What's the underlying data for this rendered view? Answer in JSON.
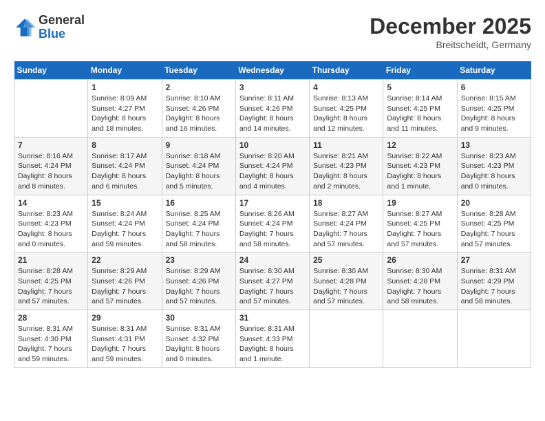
{
  "header": {
    "logo": {
      "general": "General",
      "blue": "Blue"
    },
    "month": "December 2025",
    "location": "Breitscheidt, Germany"
  },
  "weekdays": [
    "Sunday",
    "Monday",
    "Tuesday",
    "Wednesday",
    "Thursday",
    "Friday",
    "Saturday"
  ],
  "weeks": [
    [
      {
        "day": "",
        "info": ""
      },
      {
        "day": "1",
        "info": "Sunrise: 8:09 AM\nSunset: 4:27 PM\nDaylight: 8 hours\nand 18 minutes."
      },
      {
        "day": "2",
        "info": "Sunrise: 8:10 AM\nSunset: 4:26 PM\nDaylight: 8 hours\nand 16 minutes."
      },
      {
        "day": "3",
        "info": "Sunrise: 8:11 AM\nSunset: 4:26 PM\nDaylight: 8 hours\nand 14 minutes."
      },
      {
        "day": "4",
        "info": "Sunrise: 8:13 AM\nSunset: 4:25 PM\nDaylight: 8 hours\nand 12 minutes."
      },
      {
        "day": "5",
        "info": "Sunrise: 8:14 AM\nSunset: 4:25 PM\nDaylight: 8 hours\nand 11 minutes."
      },
      {
        "day": "6",
        "info": "Sunrise: 8:15 AM\nSunset: 4:25 PM\nDaylight: 8 hours\nand 9 minutes."
      }
    ],
    [
      {
        "day": "7",
        "info": "Sunrise: 8:16 AM\nSunset: 4:24 PM\nDaylight: 8 hours\nand 8 minutes."
      },
      {
        "day": "8",
        "info": "Sunrise: 8:17 AM\nSunset: 4:24 PM\nDaylight: 8 hours\nand 6 minutes."
      },
      {
        "day": "9",
        "info": "Sunrise: 8:18 AM\nSunset: 4:24 PM\nDaylight: 8 hours\nand 5 minutes."
      },
      {
        "day": "10",
        "info": "Sunrise: 8:20 AM\nSunset: 4:24 PM\nDaylight: 8 hours\nand 4 minutes."
      },
      {
        "day": "11",
        "info": "Sunrise: 8:21 AM\nSunset: 4:23 PM\nDaylight: 8 hours\nand 2 minutes."
      },
      {
        "day": "12",
        "info": "Sunrise: 8:22 AM\nSunset: 4:23 PM\nDaylight: 8 hours\nand 1 minute."
      },
      {
        "day": "13",
        "info": "Sunrise: 8:23 AM\nSunset: 4:23 PM\nDaylight: 8 hours\nand 0 minutes."
      }
    ],
    [
      {
        "day": "14",
        "info": "Sunrise: 8:23 AM\nSunset: 4:23 PM\nDaylight: 8 hours\nand 0 minutes."
      },
      {
        "day": "15",
        "info": "Sunrise: 8:24 AM\nSunset: 4:24 PM\nDaylight: 7 hours\nand 59 minutes."
      },
      {
        "day": "16",
        "info": "Sunrise: 8:25 AM\nSunset: 4:24 PM\nDaylight: 7 hours\nand 58 minutes."
      },
      {
        "day": "17",
        "info": "Sunrise: 8:26 AM\nSunset: 4:24 PM\nDaylight: 7 hours\nand 58 minutes."
      },
      {
        "day": "18",
        "info": "Sunrise: 8:27 AM\nSunset: 4:24 PM\nDaylight: 7 hours\nand 57 minutes."
      },
      {
        "day": "19",
        "info": "Sunrise: 8:27 AM\nSunset: 4:25 PM\nDaylight: 7 hours\nand 57 minutes."
      },
      {
        "day": "20",
        "info": "Sunrise: 8:28 AM\nSunset: 4:25 PM\nDaylight: 7 hours\nand 57 minutes."
      }
    ],
    [
      {
        "day": "21",
        "info": "Sunrise: 8:28 AM\nSunset: 4:25 PM\nDaylight: 7 hours\nand 57 minutes."
      },
      {
        "day": "22",
        "info": "Sunrise: 8:29 AM\nSunset: 4:26 PM\nDaylight: 7 hours\nand 57 minutes."
      },
      {
        "day": "23",
        "info": "Sunrise: 8:29 AM\nSunset: 4:26 PM\nDaylight: 7 hours\nand 57 minutes."
      },
      {
        "day": "24",
        "info": "Sunrise: 8:30 AM\nSunset: 4:27 PM\nDaylight: 7 hours\nand 57 minutes."
      },
      {
        "day": "25",
        "info": "Sunrise: 8:30 AM\nSunset: 4:28 PM\nDaylight: 7 hours\nand 57 minutes."
      },
      {
        "day": "26",
        "info": "Sunrise: 8:30 AM\nSunset: 4:28 PM\nDaylight: 7 hours\nand 58 minutes."
      },
      {
        "day": "27",
        "info": "Sunrise: 8:31 AM\nSunset: 4:29 PM\nDaylight: 7 hours\nand 58 minutes."
      }
    ],
    [
      {
        "day": "28",
        "info": "Sunrise: 8:31 AM\nSunset: 4:30 PM\nDaylight: 7 hours\nand 59 minutes."
      },
      {
        "day": "29",
        "info": "Sunrise: 8:31 AM\nSunset: 4:31 PM\nDaylight: 7 hours\nand 59 minutes."
      },
      {
        "day": "30",
        "info": "Sunrise: 8:31 AM\nSunset: 4:32 PM\nDaylight: 8 hours\nand 0 minutes."
      },
      {
        "day": "31",
        "info": "Sunrise: 8:31 AM\nSunset: 4:33 PM\nDaylight: 8 hours\nand 1 minute."
      },
      {
        "day": "",
        "info": ""
      },
      {
        "day": "",
        "info": ""
      },
      {
        "day": "",
        "info": ""
      }
    ]
  ]
}
